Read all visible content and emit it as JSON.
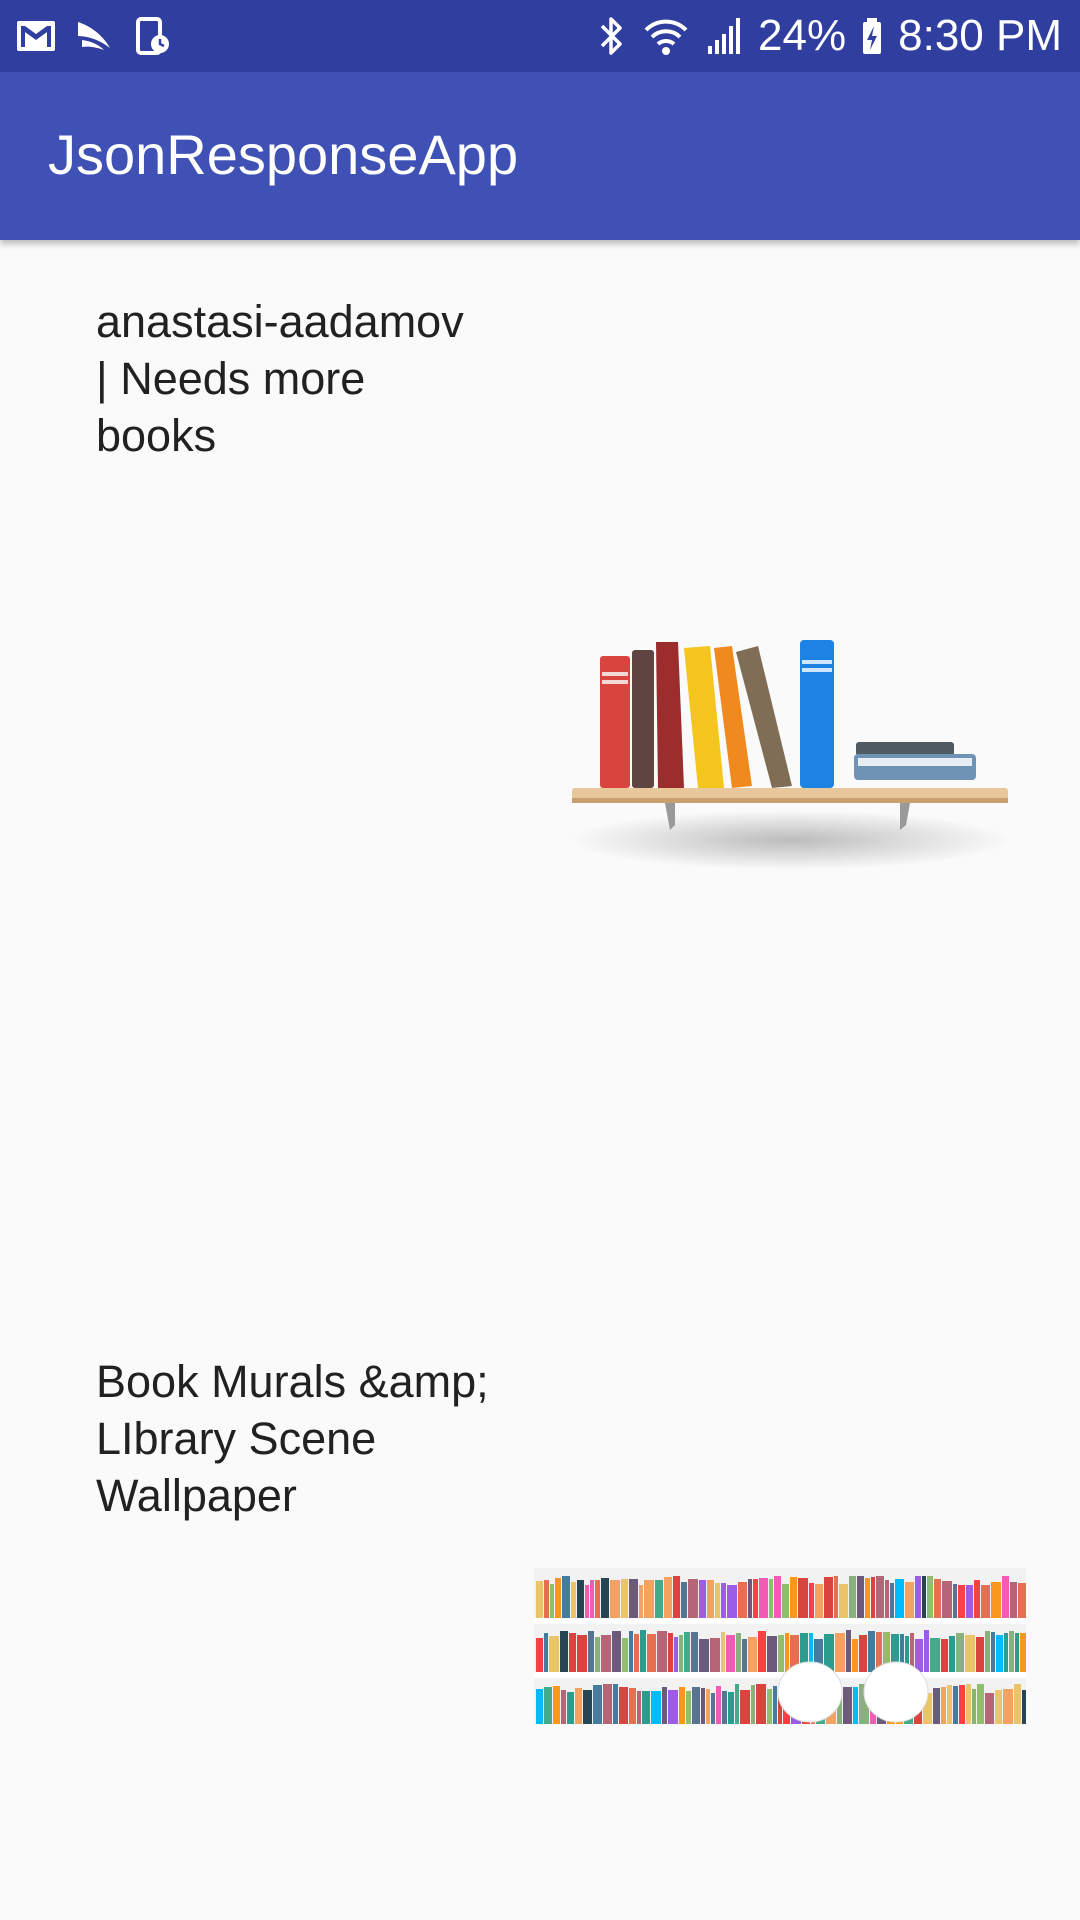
{
  "status_bar": {
    "battery": "24%",
    "time": "8:30 PM",
    "left_icons": [
      "gmail-icon",
      "sprint-icon",
      "device-schedule-icon"
    ],
    "right_icons": [
      "bluetooth-icon",
      "wifi-icon",
      "signal-icon",
      "battery-charging-icon"
    ]
  },
  "app_bar": {
    "title": "JsonResponseApp"
  },
  "items": [
    {
      "title": "anastasi-aadamov | Needs more books",
      "image": "bookshelf-illustration"
    },
    {
      "title": "Book Murals &amp; LIbrary Scene Wallpaper",
      "image": "library-wall-mural"
    }
  ]
}
